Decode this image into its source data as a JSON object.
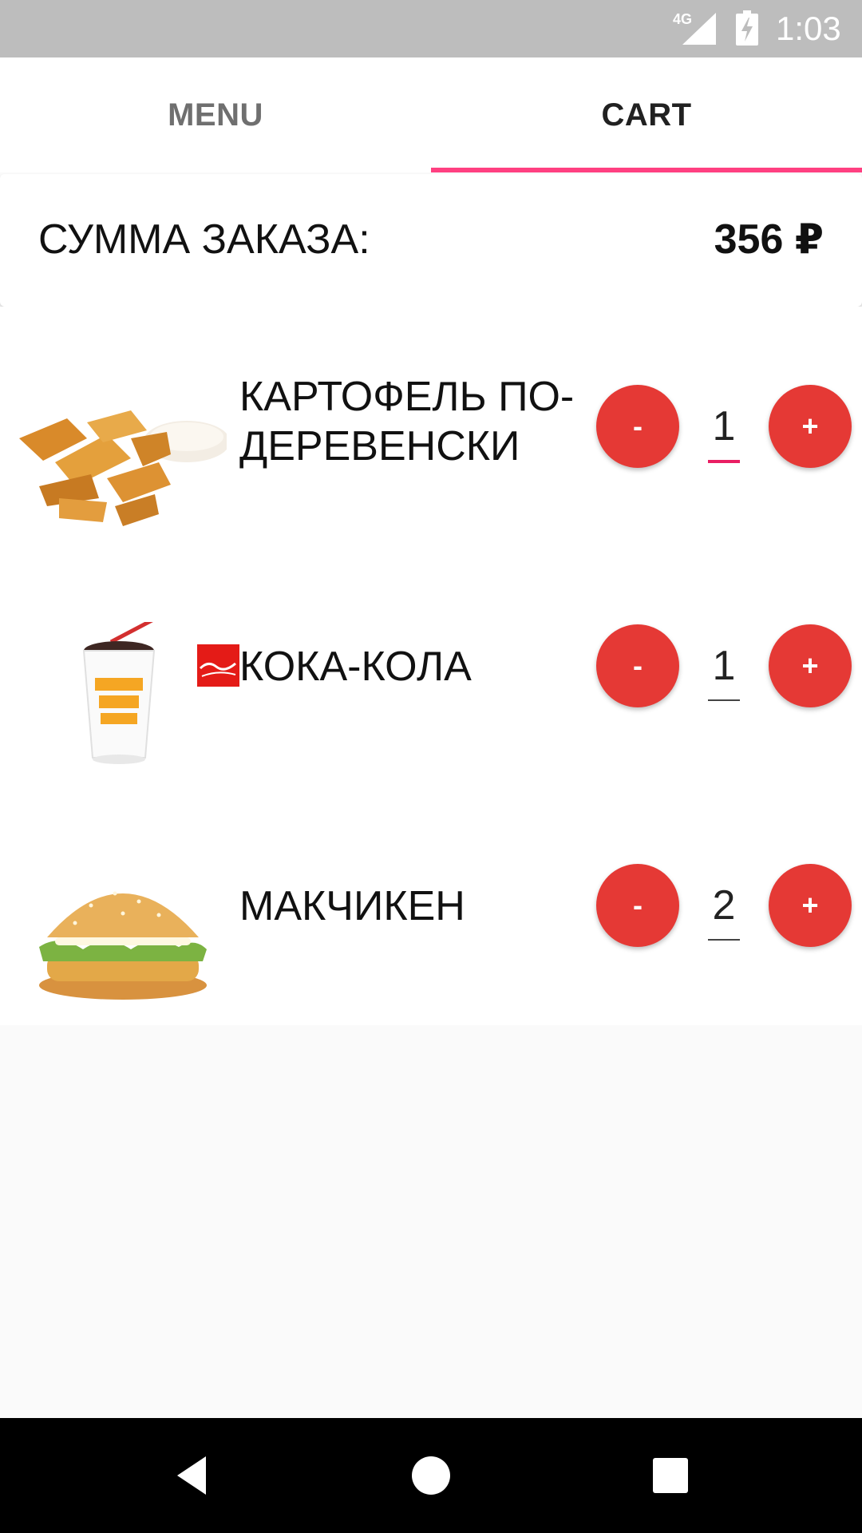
{
  "status_bar": {
    "network": "4G",
    "time": "1:03"
  },
  "tabs": [
    {
      "label": "MENU",
      "selected": false
    },
    {
      "label": "CART",
      "selected": true
    }
  ],
  "accent_color": "#ff4081",
  "button_color": "#e53935",
  "order_sum": {
    "label": "СУММА ЗАКАЗА:",
    "value": "356 ₽"
  },
  "cart_items": [
    {
      "name": "КАРТОФЕЛЬ ПО-ДЕРЕВЕНСКИ",
      "quantity": "1",
      "image": "potato-wedges-image",
      "minus_label": "-",
      "plus_label": "+"
    },
    {
      "name": "КОКА-КОЛА",
      "quantity": "1",
      "image": "cola-cup-image",
      "minus_label": "-",
      "plus_label": "+"
    },
    {
      "name": "МАКЧИКЕН",
      "quantity": "2",
      "image": "chicken-burger-image",
      "minus_label": "-",
      "plus_label": "+"
    }
  ],
  "nav_bar": [
    "back-icon",
    "home-icon",
    "recents-icon"
  ]
}
